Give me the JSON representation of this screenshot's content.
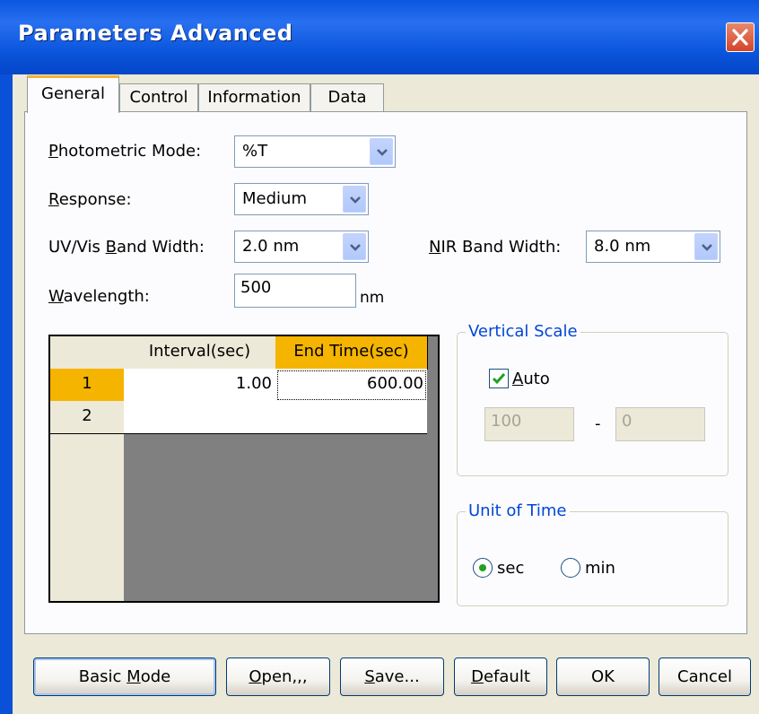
{
  "window": {
    "title": "Parameters  Advanced"
  },
  "tabs": [
    {
      "label": "General",
      "active": true
    },
    {
      "label": "Control",
      "active": false
    },
    {
      "label": "Information",
      "active": false
    },
    {
      "label": "Data",
      "active": false
    }
  ],
  "general": {
    "photometric_mode": {
      "label_u": "P",
      "label_rest": "hotometric Mode:",
      "value": "%T"
    },
    "response": {
      "label_u": "R",
      "label_rest": "esponse:",
      "value": "Medium"
    },
    "uvvis_band_width": {
      "label_pre": "UV/Vis ",
      "label_u": "B",
      "label_rest": "and Width:",
      "value": "2.0 nm"
    },
    "nir_band_width": {
      "label_u": "N",
      "label_rest": "IR Band Width:",
      "value": "8.0 nm"
    },
    "wavelength": {
      "label_u": "W",
      "label_rest": "avelength:",
      "value": "500",
      "unit": "nm"
    }
  },
  "table": {
    "columns": [
      "Interval(sec)",
      "End Time(sec)"
    ],
    "rows": [
      {
        "index": "1",
        "interval": "1.00",
        "end_time": "600.00"
      },
      {
        "index": "2",
        "interval": "",
        "end_time": ""
      }
    ]
  },
  "vertical_scale": {
    "title": "Vertical Scale",
    "auto_u": "A",
    "auto_rest": "uto",
    "auto_checked": true,
    "max": "100",
    "separator": "-",
    "min": "0"
  },
  "unit_of_time": {
    "title": "Unit of Time",
    "options": [
      {
        "label": "sec",
        "selected": true
      },
      {
        "label": "min",
        "selected": false
      }
    ]
  },
  "buttons": {
    "basic_mode": {
      "pre": "Basic ",
      "u": "M",
      "rest": "ode"
    },
    "open": {
      "u": "O",
      "rest": "pen,,,"
    },
    "save": {
      "u": "S",
      "rest": "ave..."
    },
    "default": {
      "u": "D",
      "rest": "efault"
    },
    "ok": "OK",
    "cancel": "Cancel"
  },
  "colors": {
    "title_bar": "#0a56e0",
    "selected_cell": "#f5b400",
    "group_title": "#0046d5",
    "face": "#ece9d8"
  }
}
